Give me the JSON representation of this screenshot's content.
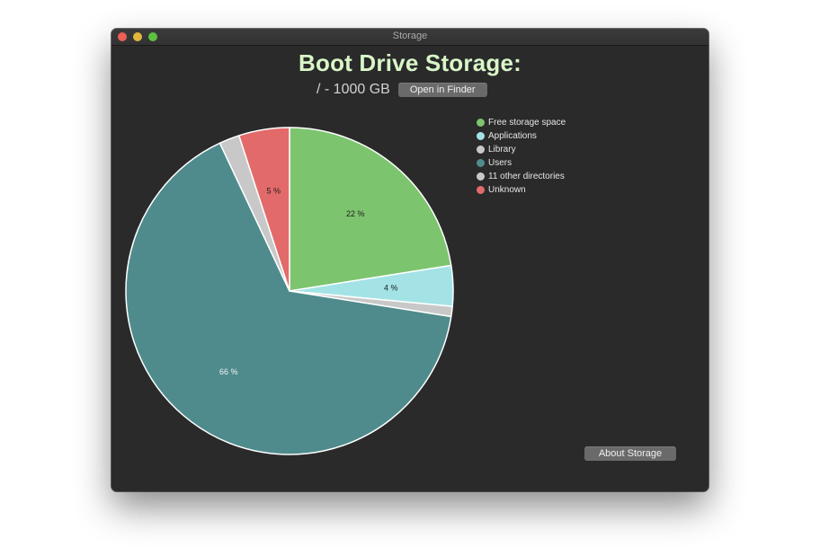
{
  "window": {
    "title": "Storage"
  },
  "header": {
    "title": "Boot Drive Storage:",
    "drive_info": "/ - 1000 GB",
    "open_button_label": "Open in Finder"
  },
  "footer": {
    "about_button_label": "About Storage"
  },
  "chart_data": {
    "type": "pie",
    "slices": [
      {
        "name": "Free storage space",
        "value": 22.5,
        "color": "#7dc46e",
        "label": "22 %",
        "label_color": "#1e1e1e"
      },
      {
        "name": "Applications",
        "value": 4.0,
        "color": "#a3e3e6",
        "label": "4 %",
        "label_color": "#1e1e1e"
      },
      {
        "name": "Library",
        "value": 1.0,
        "color": "#c8c8c8",
        "label": "",
        "label_color": "#1e1e1e"
      },
      {
        "name": "Users",
        "value": 65.5,
        "color": "#4f8b8c",
        "label": "66 %",
        "label_color": "#f2f2f2"
      },
      {
        "name": "11 other directories",
        "value": 2.0,
        "color": "#c8c8c8",
        "label": "",
        "label_color": "#1e1e1e"
      },
      {
        "name": "Unknown",
        "value": 5.0,
        "color": "#e36a6a",
        "label": "5 %",
        "label_color": "#1e1e1e"
      }
    ],
    "legend_position": "top-right"
  }
}
